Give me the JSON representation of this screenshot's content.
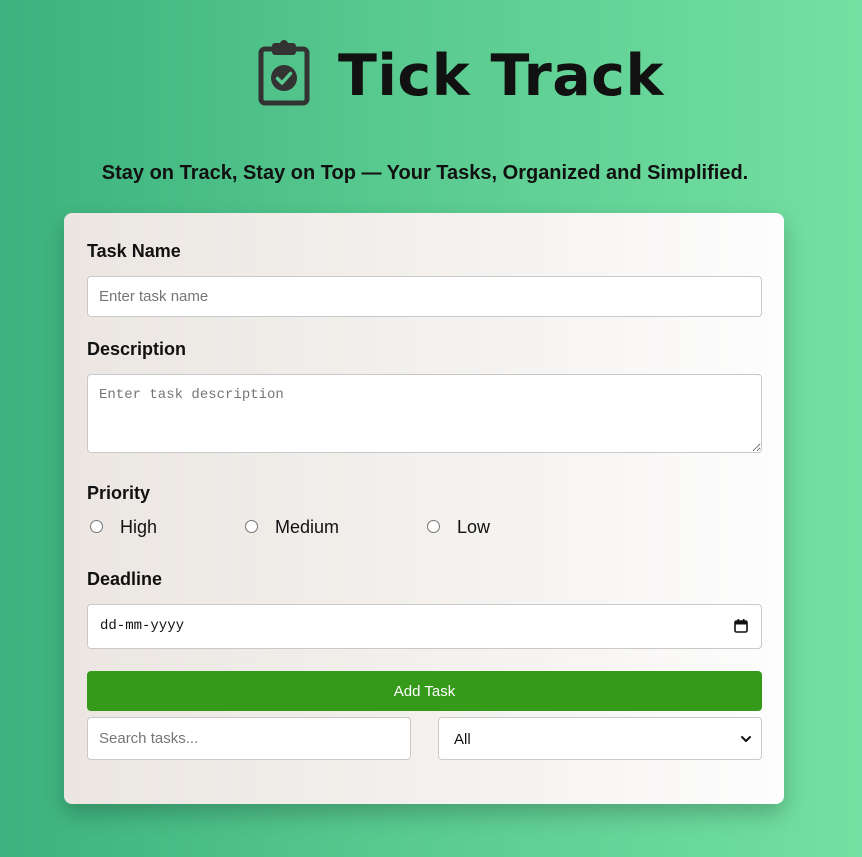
{
  "header": {
    "app_title": "Tick Track",
    "logo_icon": "clipboard-check-icon",
    "tagline": "Stay on Track, Stay on Top — Your Tasks, Organized and Simplified."
  },
  "form": {
    "task_name": {
      "label": "Task Name",
      "placeholder": "Enter task name",
      "value": ""
    },
    "description": {
      "label": "Description",
      "placeholder": "Enter task description",
      "value": ""
    },
    "priority": {
      "label": "Priority",
      "options": [
        "High",
        "Medium",
        "Low"
      ],
      "selected": null
    },
    "deadline": {
      "label": "Deadline",
      "placeholder": "dd-mm-yyyy",
      "icon": "calendar-icon"
    },
    "add_button_label": "Add Task"
  },
  "filters": {
    "search_placeholder": "Search tasks...",
    "search_value": "",
    "filter_selected": "All",
    "filter_icon": "chevron-down-icon"
  },
  "colors": {
    "background_start": "#3cb27e",
    "background_end": "#74e0a1",
    "add_button": "#359a1a",
    "card": "#f2efec"
  }
}
